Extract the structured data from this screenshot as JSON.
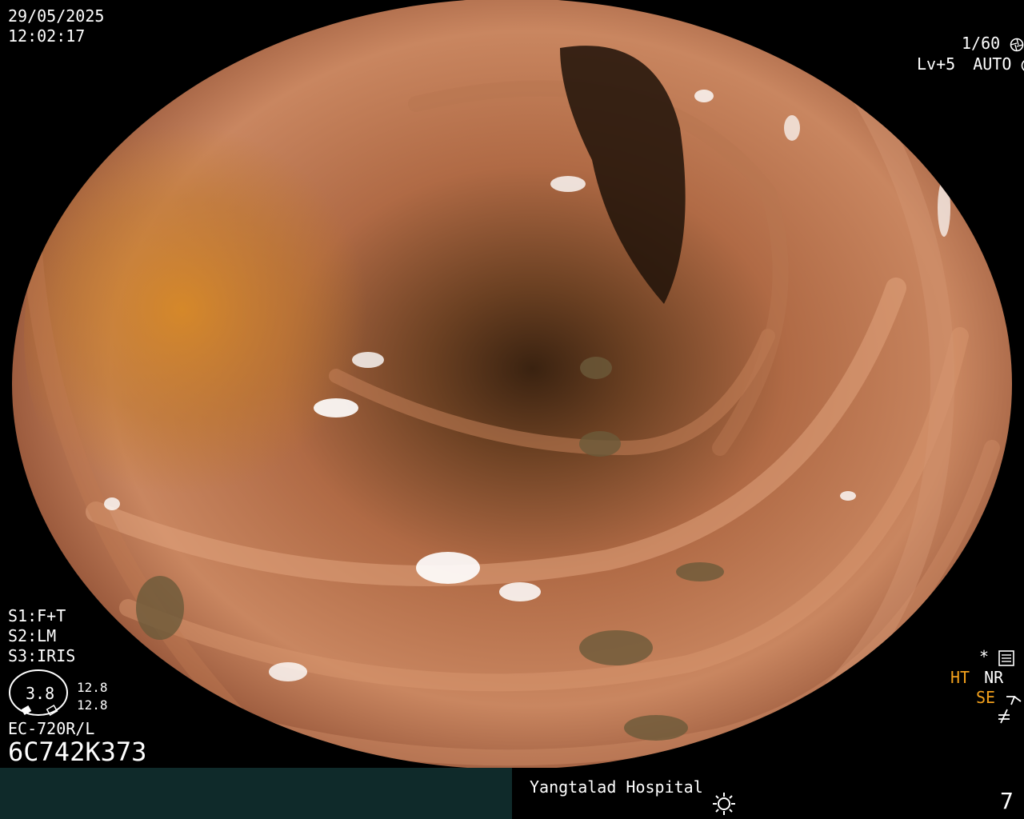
{
  "osd": {
    "date": "29/05/2025",
    "time": "12:02:17",
    "shutter": "1/60",
    "light_level": "Lv+5",
    "iris_mode": "AUTO",
    "s1": "S1:F+T",
    "s2": "S2:LM",
    "s3": "S3:IRIS",
    "zoom_value": "3.8",
    "zoom_top": "12.8",
    "zoom_bottom": "12.8",
    "scope_model": "EC-720R/L",
    "serial": "6C742K373",
    "star": "*",
    "ht": "HT",
    "nr": "NR",
    "se": "SE",
    "hospital": "Yangtalad Hospital",
    "page_number": "7"
  },
  "icons": [
    "aperture-icon",
    "settings-icon",
    "brightness-icon",
    "signal-icon",
    "no-signal-icon",
    "scope-zoom-icon"
  ],
  "colors": {
    "osd_text": "#ffffff",
    "accent": "#f2a01c",
    "bar": "#0f2a2a"
  }
}
